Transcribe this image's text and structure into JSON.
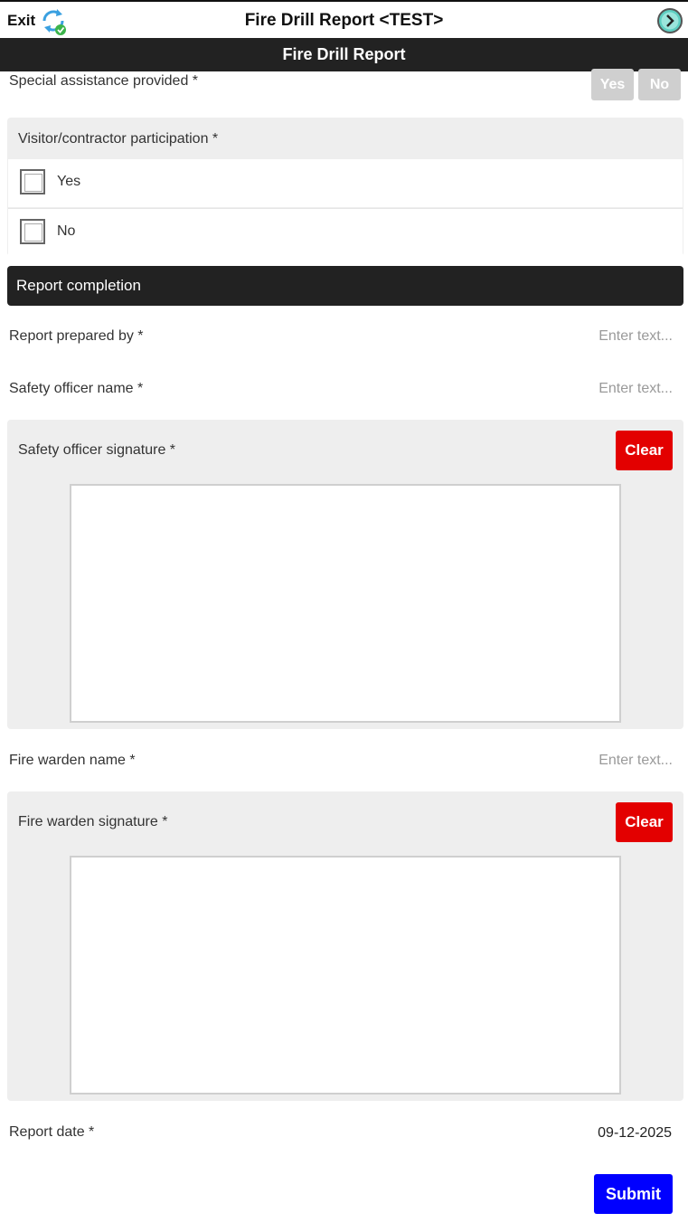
{
  "header": {
    "exit_label": "Exit",
    "title": "Fire Drill Report <TEST>",
    "subtitle": "Fire Drill Report"
  },
  "special_assistance": {
    "label": "Special assistance provided *",
    "yes": "Yes",
    "no": "No"
  },
  "visitor": {
    "label": "Visitor/contractor participation *",
    "options": [
      "Yes",
      "No"
    ]
  },
  "section": {
    "title": "Report completion"
  },
  "prepared_by": {
    "label": "Report prepared by *",
    "placeholder": "Enter text..."
  },
  "safety_officer_name": {
    "label": "Safety officer name *",
    "placeholder": "Enter text..."
  },
  "safety_officer_signature": {
    "label": "Safety officer signature *",
    "clear": "Clear"
  },
  "fire_warden_name": {
    "label": "Fire warden name *",
    "placeholder": "Enter text..."
  },
  "fire_warden_signature": {
    "label": "Fire warden signature *",
    "clear": "Clear"
  },
  "report_date": {
    "label": "Report date *",
    "value": "09-12-2025"
  },
  "submit_label": "Submit",
  "colors": {
    "header_dark": "#222222",
    "clear_red": "#e30000",
    "submit_blue": "#0000ff",
    "sync_blue": "#3aa0e0",
    "sync_green": "#3cb44b",
    "next_teal": "#5ecfc2"
  }
}
